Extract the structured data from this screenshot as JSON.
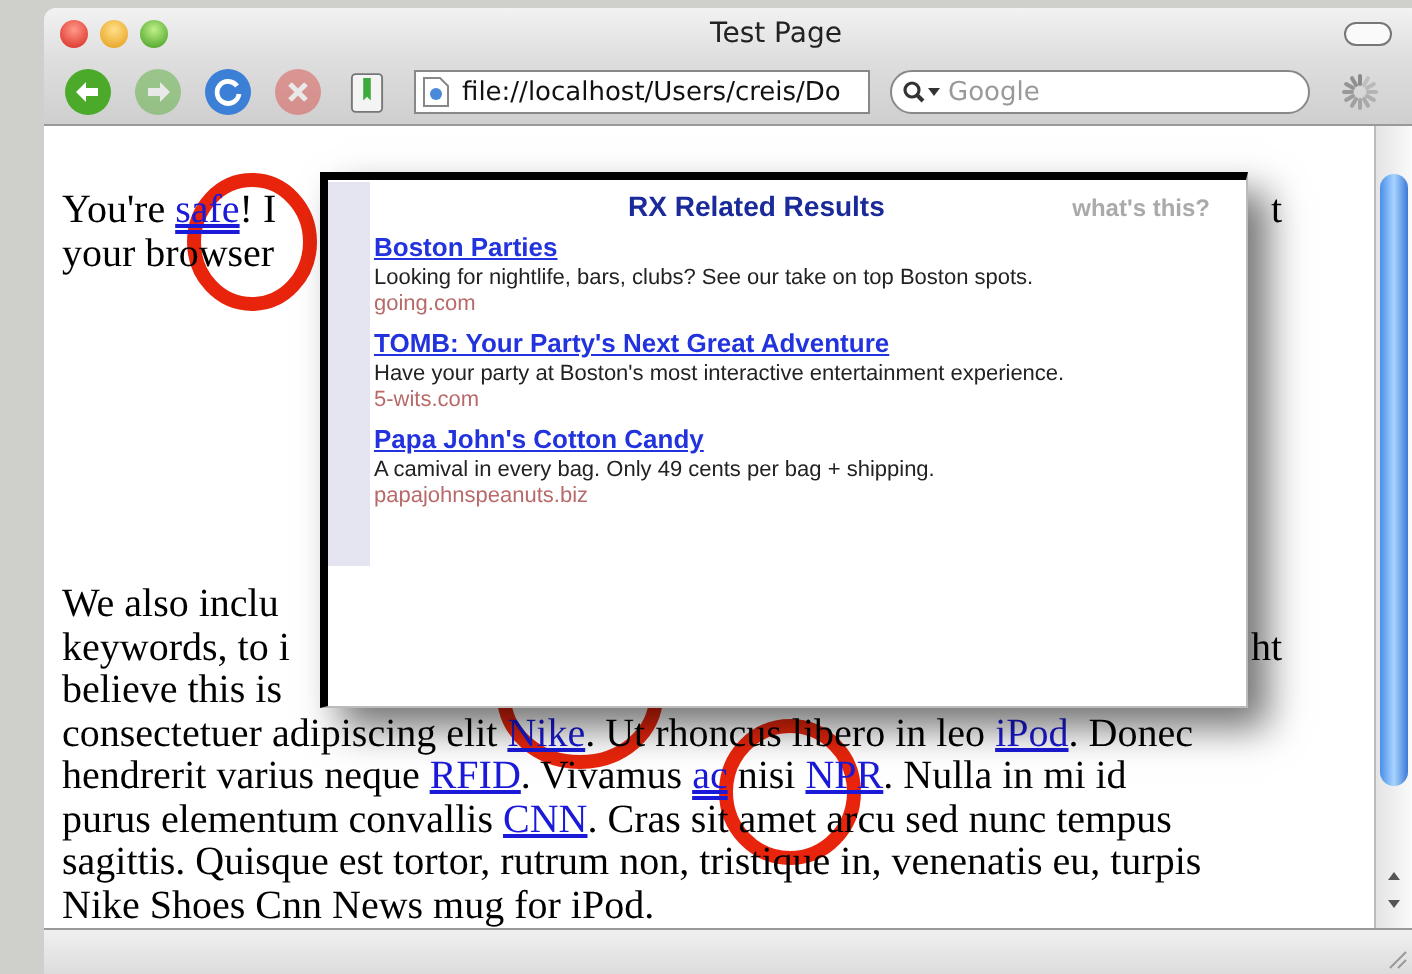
{
  "window": {
    "title": "Test Page"
  },
  "toolbar": {
    "buttons": [
      {
        "kind": "back",
        "disabled": false
      },
      {
        "kind": "forward",
        "disabled": true
      },
      {
        "kind": "reload",
        "disabled": false
      },
      {
        "kind": "stop",
        "disabled": true
      },
      {
        "kind": "bookmarks",
        "disabled": false
      }
    ],
    "address": "file://localhost/Users/creis/Do",
    "search": {
      "placeholder": "Google"
    }
  },
  "page": {
    "paragraphs": [
      {
        "lines": [
          {
            "left": [
              {
                "kind": "text",
                "text": "You're "
              },
              {
                "kind": "keyword",
                "text": "safe"
              },
              {
                "kind": "text",
                "text": "! I"
              }
            ],
            "right": "t"
          },
          {
            "left": [
              {
                "kind": "text",
                "text": "your browser"
              }
            ]
          }
        ]
      },
      {
        "lines": [
          {
            "left": [
              {
                "kind": "text",
                "text": "We also inclu"
              }
            ]
          },
          {
            "left": [
              {
                "kind": "text",
                "text": "keywords, to i"
              }
            ],
            "right": "ht"
          },
          {
            "left": [
              {
                "kind": "text",
                "text": "believe this is"
              }
            ]
          },
          {
            "left": [
              {
                "kind": "text",
                "text": "consectetuer adipiscing elit "
              },
              {
                "kind": "link",
                "text": "Nike"
              },
              {
                "kind": "text",
                "text": ". Ut rhoncus libero in leo "
              },
              {
                "kind": "link",
                "text": "iPod"
              },
              {
                "kind": "text",
                "text": ". Donec"
              }
            ]
          },
          {
            "left": [
              {
                "kind": "text",
                "text": "hendrerit varius neque "
              },
              {
                "kind": "link",
                "text": "RFID"
              },
              {
                "kind": "text",
                "text": ". Vivamus "
              },
              {
                "kind": "keyword",
                "text": "ac"
              },
              {
                "kind": "text",
                "text": " nisi "
              },
              {
                "kind": "link",
                "text": "NPR"
              },
              {
                "kind": "text",
                "text": ". Nulla in mi id"
              }
            ]
          },
          {
            "left": [
              {
                "kind": "text",
                "text": "purus elementum convallis "
              },
              {
                "kind": "link",
                "text": "CNN"
              },
              {
                "kind": "text",
                "text": ". Cras sit amet arcu sed nunc tempus"
              }
            ]
          },
          {
            "left": [
              {
                "kind": "text",
                "text": "sagittis. Quisque est tortor, rutrum non, tristique in, venenatis eu, turpis"
              }
            ]
          },
          {
            "left": [
              {
                "kind": "text",
                "text": "Nike Shoes Cnn News mug for iPod."
              }
            ]
          }
        ]
      }
    ]
  },
  "popup": {
    "title": "RX Related Results",
    "help_link": "what's this?",
    "results": [
      {
        "title": "Boston Parties",
        "description": "Looking for nightlife, bars, clubs? See our take on top Boston spots.",
        "url": "going.com"
      },
      {
        "title": "TOMB: Your Party's Next Great Adventure",
        "description": "Have your party at Boston's most interactive entertainment experience.",
        "url": "5-wits.com"
      },
      {
        "title": "Papa John's Cotton Candy",
        "description": "A camival in every bag. Only 49 cents per bag + shipping.",
        "url": "papajohnspeanuts.biz"
      }
    ]
  }
}
